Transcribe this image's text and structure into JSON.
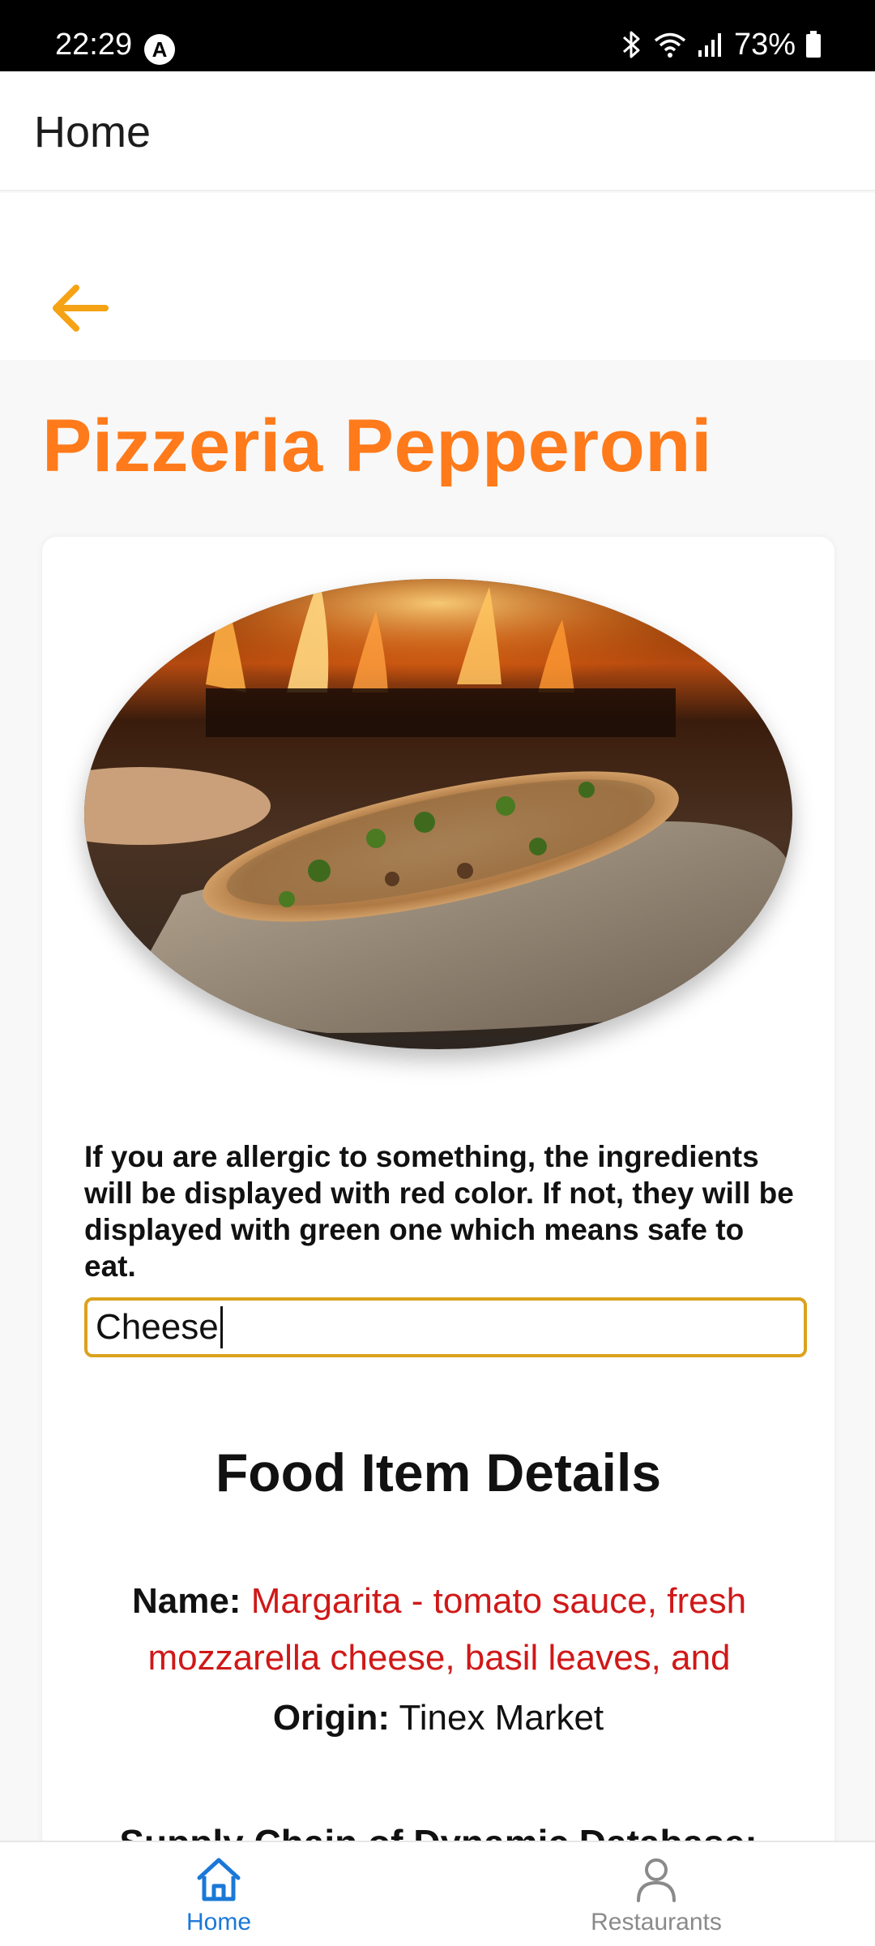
{
  "status_bar": {
    "time": "22:29",
    "app_badge": "A",
    "battery": "73%",
    "icons": [
      "bluetooth-icon",
      "wifi-icon",
      "signal-icon",
      "battery-icon"
    ]
  },
  "header": {
    "title": "Home"
  },
  "back": {
    "icon": "arrow-left-icon",
    "color": "#f5a314"
  },
  "restaurant": {
    "title": "Pizzeria Pepperoni",
    "title_color": "#ff7a1a"
  },
  "card": {
    "image_alt": "pizza on peel in wood-fired oven",
    "notice": "If you are allergic to something, the ingredients will be displayed with red color. If not, they will be displayed with green one which means safe to eat.",
    "allergen_input": {
      "value": "Cheese",
      "border_color": "#dba21e"
    },
    "details": {
      "heading": "Food Item Details",
      "name_label": "Name:",
      "name_value": "Margarita - tomato sauce, fresh mozzarella cheese, basil leaves, and",
      "name_value_color": "#d01818",
      "origin_label": "Origin:",
      "origin_value": "Tinex Market",
      "supply_chain": "Supply Chain of Dynamic Database:"
    }
  },
  "bottom_nav": {
    "items": [
      {
        "label": "Home",
        "icon": "home-icon",
        "active": true,
        "color": "#1a78d8"
      },
      {
        "label": "Restaurants",
        "icon": "person-icon",
        "active": false,
        "color": "#8a8a8a"
      }
    ]
  }
}
